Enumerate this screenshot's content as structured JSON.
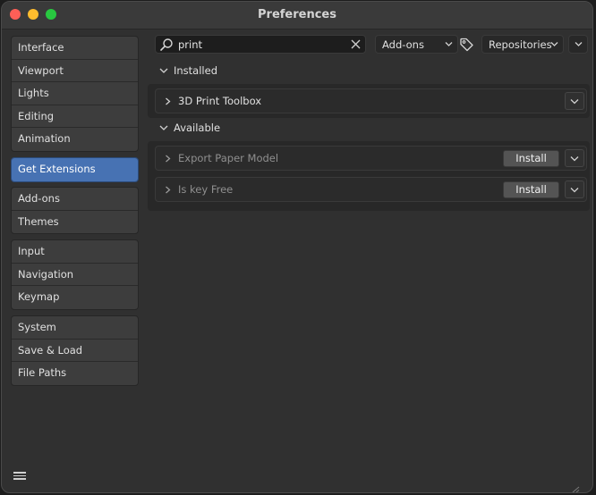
{
  "window": {
    "title": "Preferences"
  },
  "sidebar": {
    "groups": [
      {
        "items": [
          {
            "label": "Interface"
          },
          {
            "label": "Viewport"
          },
          {
            "label": "Lights"
          },
          {
            "label": "Editing"
          },
          {
            "label": "Animation"
          }
        ]
      },
      {
        "items": [
          {
            "label": "Get Extensions",
            "active": true
          }
        ]
      },
      {
        "items": [
          {
            "label": "Add-ons"
          },
          {
            "label": "Themes"
          }
        ]
      },
      {
        "items": [
          {
            "label": "Input"
          },
          {
            "label": "Navigation"
          },
          {
            "label": "Keymap"
          }
        ]
      },
      {
        "items": [
          {
            "label": "System"
          },
          {
            "label": "Save & Load"
          },
          {
            "label": "File Paths"
          }
        ]
      }
    ]
  },
  "toolbar": {
    "search": {
      "value": "print"
    },
    "type_filter": "Add-ons",
    "repositories": "Repositories"
  },
  "sections": {
    "installed": {
      "label": "Installed",
      "items": [
        {
          "name": "3D Print Toolbox"
        }
      ]
    },
    "available": {
      "label": "Available",
      "items": [
        {
          "name": "Export Paper Model",
          "button": "Install"
        },
        {
          "name": "Is key Free",
          "button": "Install"
        }
      ]
    }
  },
  "colors": {
    "accent": "#4772b3",
    "background": "#303030"
  },
  "icons": [
    "search-icon",
    "clear-icon",
    "tag-icon",
    "chevron-down-icon",
    "chevron-right-icon",
    "hamburger-menu-icon"
  ]
}
